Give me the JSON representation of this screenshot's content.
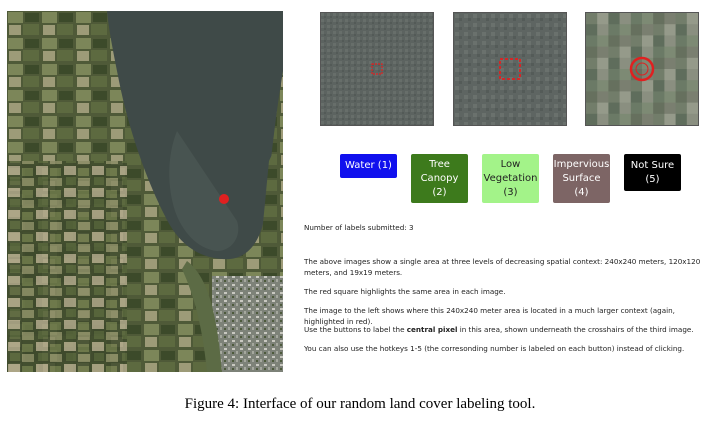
{
  "buttons": [
    {
      "lines": [
        "Water (1)"
      ],
      "bg": "#1010ee",
      "fg": "#ffffff"
    },
    {
      "lines": [
        "Tree",
        "Canopy",
        "(2)"
      ],
      "bg": "#3d7a1c",
      "fg": "#ffffff"
    },
    {
      "lines": [
        "Low",
        "Vegetation",
        "(3)"
      ],
      "bg": "#a3f389",
      "fg": "#222222"
    },
    {
      "lines": [
        "Impervious",
        "Surface",
        "(4)"
      ],
      "bg": "#7d6565",
      "fg": "#ffffff"
    },
    {
      "lines": [
        "Not Sure",
        "(5)"
      ],
      "bg": "#000000",
      "fg": "#ffffff"
    }
  ],
  "status": {
    "labels_submitted": "Number of labels submitted: 3"
  },
  "instructions": {
    "p1": "The above images show a single area at three levels of decreasing spatial context: 240x240 meters, 120x120 meters, and 19x19 meters.",
    "p2": "The red square highlights the same area in each image.",
    "p3": "The image to the left shows where this 240x240 meter area is located in a much larger context (again, highlighted in red).",
    "p4_pre": "Use the buttons to label the ",
    "p4_bold": "central pixel",
    "p4_post": " in this area, shown underneath the crosshairs of the third image.",
    "p5": "You can also use the hotkeys 1-5 (the corresonding number is labeled on each button) instead of clicking."
  },
  "caption": "Figure 4: Interface of our random land cover labeling tool.",
  "colors": {
    "highlight": "#e02020",
    "water": "#3f4a48"
  }
}
